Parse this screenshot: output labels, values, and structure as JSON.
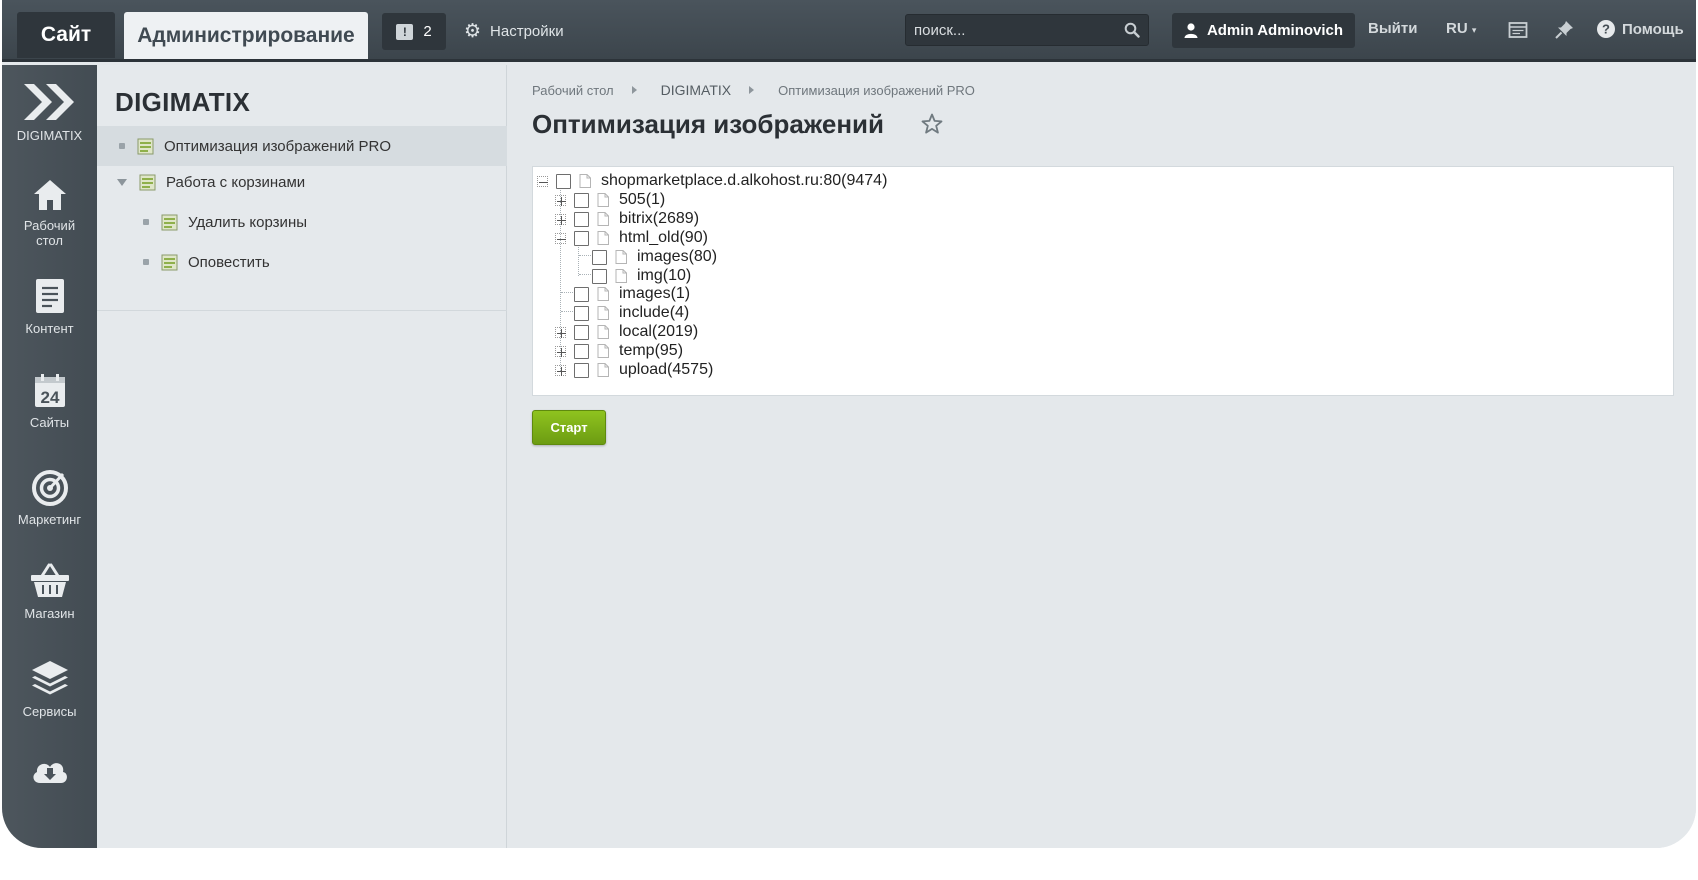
{
  "topbar": {
    "tab_site": "Сайт",
    "tab_admin": "Администрирование",
    "notifications_count": "2",
    "settings_label": "Настройки",
    "search_placeholder": "поиск...",
    "user_name": "Admin Adminovich",
    "logout_label": "Выйти",
    "language_label": "RU",
    "help_label": "Помощь"
  },
  "leftmenu": {
    "items": [
      {
        "label": "DIGIMATIX",
        "icon": "digimatix-chevrons-icon"
      },
      {
        "label": "Рабочий стол",
        "icon": "home-icon"
      },
      {
        "label": "Контент",
        "icon": "document-icon"
      },
      {
        "label": "Сайты",
        "icon": "calendar-24-icon"
      },
      {
        "label": "Маркетинг",
        "icon": "target-icon"
      },
      {
        "label": "Магазин",
        "icon": "basket-icon"
      },
      {
        "label": "Сервисы",
        "icon": "layers-icon"
      },
      {
        "label": "",
        "icon": "cloud-download-icon"
      }
    ]
  },
  "module_panel": {
    "title": "DIGIMATIX",
    "items": [
      {
        "label": "Оптимизация изображений PRO",
        "active": true
      },
      {
        "label": "Работа с корзинами",
        "expanded": true
      },
      {
        "label": "Удалить корзины"
      },
      {
        "label": "Оповестить"
      }
    ]
  },
  "content": {
    "breadcrumb": [
      "Рабочий стол",
      "DIGIMATIX",
      "Оптимизация изображений PRO"
    ],
    "page_title": "Оптимизация изображений",
    "tree": {
      "root": "shopmarketplace.d.alkohost.ru:80(9474)",
      "children": [
        {
          "label": "505(1)",
          "toggle": "plus"
        },
        {
          "label": "bitrix(2689)",
          "toggle": "plus"
        },
        {
          "label": "html_old(90)",
          "toggle": "minus"
        },
        {
          "label": "images(80)",
          "toggle": "none"
        },
        {
          "label": "img(10)",
          "toggle": "none"
        },
        {
          "label": "images(1)",
          "toggle": "none"
        },
        {
          "label": "include(4)",
          "toggle": "none"
        },
        {
          "label": "local(2019)",
          "toggle": "plus"
        },
        {
          "label": "temp(95)",
          "toggle": "plus"
        },
        {
          "label": "upload(4575)",
          "toggle": "plus"
        }
      ]
    },
    "start_button": "Старт"
  },
  "colors": {
    "topbar": "#434c53",
    "sidebar": "#4a535a",
    "panel": "#e5e9ec",
    "start_button": "#7db11a"
  }
}
